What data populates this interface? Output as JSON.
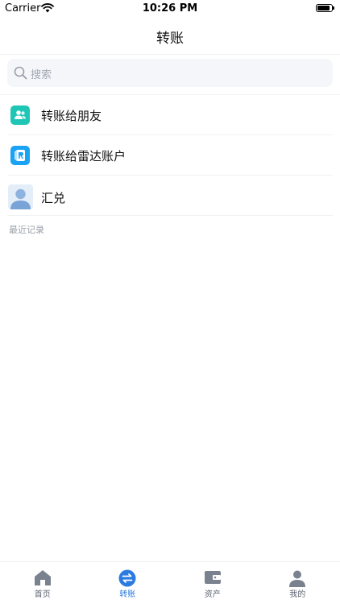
{
  "status_bar": {
    "carrier": "Carrier",
    "time": "10:26 PM"
  },
  "nav": {
    "title": "转账"
  },
  "search": {
    "placeholder": "搜索"
  },
  "list": {
    "items": [
      {
        "label": "转账给朋友",
        "icon": "friends-icon",
        "color": "#1fc6b6"
      },
      {
        "label": "转账给雷达账户",
        "icon": "radar-account-icon",
        "color": "#1aa3f5"
      },
      {
        "label": "汇兑",
        "icon": "avatar-icon",
        "color": "#8fb3e0"
      }
    ]
  },
  "recent": {
    "label": "最近记录"
  },
  "tabbar": {
    "active_color": "#2b7be0",
    "items": [
      {
        "label": "首页",
        "icon": "home-icon"
      },
      {
        "label": "转账",
        "icon": "transfer-icon",
        "active": true
      },
      {
        "label": "资产",
        "icon": "wallet-icon"
      },
      {
        "label": "我的",
        "icon": "user-icon"
      }
    ]
  }
}
